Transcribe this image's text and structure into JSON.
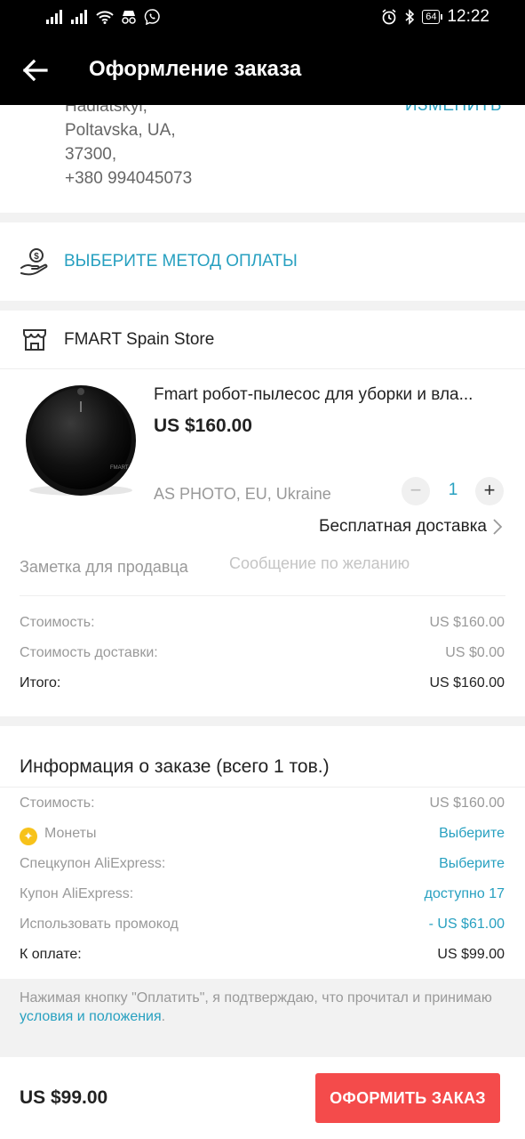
{
  "status_bar": {
    "time": "12:22",
    "battery": "64"
  },
  "header": {
    "title": "Оформление заказа"
  },
  "address": {
    "lines": [
      "Hadiatskyi,",
      "Poltavska, UA,",
      "37300,",
      "+380 994045073"
    ],
    "change_label": "ИЗМЕНИТЬ"
  },
  "payment": {
    "label": "ВЫБЕРИТЕ МЕТОД ОПЛАТЫ"
  },
  "store": {
    "name": "FMART Spain Store",
    "product": {
      "title": "Fmart робот-пылесос для уборки и вла...",
      "price": "US $160.00",
      "variant": "AS PHOTO, EU, Ukraine",
      "quantity": "1",
      "minus": "−",
      "plus": "+",
      "shipping": "Бесплатная доставка"
    },
    "note_label": "Заметка для продавца",
    "note_placeholder": "Сообщение по желанию",
    "summary": [
      {
        "label": "Стоимость:",
        "value": "US $160.00"
      },
      {
        "label": "Стоимость доставки:",
        "value": "US $0.00"
      },
      {
        "label": "Итого:",
        "value": "US $160.00"
      }
    ]
  },
  "order_info": {
    "title": "Информация о заказе (всего 1 тов.)",
    "rows": [
      {
        "label": "Стоимость:",
        "value": "US $160.00"
      },
      {
        "label": "Монеты",
        "value": "Выберите"
      },
      {
        "label": "Спецкупон AliExpress:",
        "value": "Выберите"
      },
      {
        "label": "Купон AliExpress:",
        "value": "доступно 17"
      },
      {
        "label": "Использовать промокод",
        "value": "- US $61.00"
      },
      {
        "label": "К оплате:",
        "value": "US $99.00"
      }
    ]
  },
  "terms": {
    "text": "Нажимая кнопку \"Оплатить\", я подтверждаю, что прочитал и принимаю ",
    "link": "условия и положения",
    "end": "."
  },
  "footer": {
    "total": "US $99.00",
    "button_label": "ОФОРМИТЬ ЗАКАЗ"
  },
  "colors": {
    "accent": "#27a0c0",
    "button": "#f44b4b",
    "coin": "#f7c21a"
  }
}
